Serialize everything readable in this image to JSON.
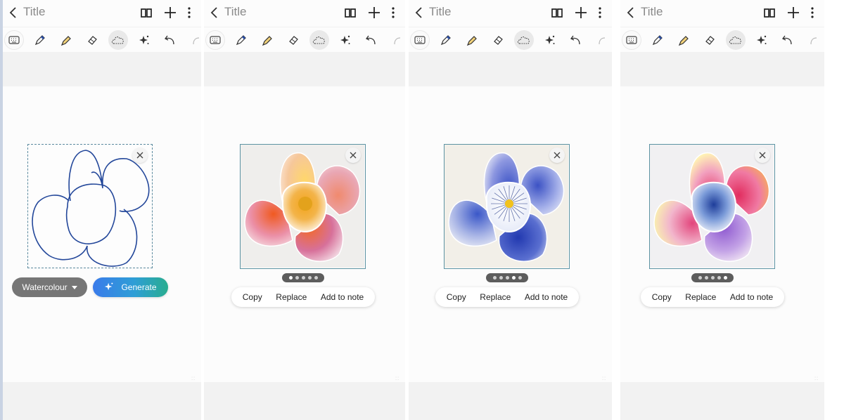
{
  "app": {
    "note_title": "Title"
  },
  "toolbar": {
    "tools": [
      "keyboard-icon",
      "pen-icon",
      "highlighter-icon",
      "eraser-icon",
      "lasso-icon",
      "ai-sparkle-icon",
      "undo-icon",
      "redo-icon"
    ],
    "pen_color": "#2a4fa8",
    "highlighter_color": "#f2d27a"
  },
  "header": {
    "icons": [
      "back-icon",
      "book-view-icon",
      "add-icon",
      "more-options-icon"
    ]
  },
  "panels": [
    {
      "state": "sketch",
      "style_selector": {
        "label": "Watercolour"
      },
      "generate_button": {
        "label": "Generate"
      },
      "sketch_stroke_color": "#23479a"
    },
    {
      "state": "result",
      "image_description": "watercolour flower, orange and pink petals with yellow centre",
      "pager": {
        "count": 5,
        "active": 0
      },
      "actions": {
        "copy": "Copy",
        "replace": "Replace",
        "add": "Add to note"
      }
    },
    {
      "state": "result",
      "image_description": "watercolour pansy, blue and white petals with yellow centre",
      "pager": {
        "count": 5,
        "active": 3
      },
      "actions": {
        "copy": "Copy",
        "replace": "Replace",
        "add": "Add to note"
      }
    },
    {
      "state": "result",
      "image_description": "watercolour flower, pink, yellow and purple petals with blue centre",
      "pager": {
        "count": 5,
        "active": 4
      },
      "actions": {
        "copy": "Copy",
        "replace": "Replace",
        "add": "Add to note"
      }
    }
  ],
  "colors": {
    "generate_gradient_start": "#3a7bea",
    "generate_gradient_end": "#29ad8f",
    "style_pill": "#767676",
    "selection_border": "#5b8a9e"
  }
}
